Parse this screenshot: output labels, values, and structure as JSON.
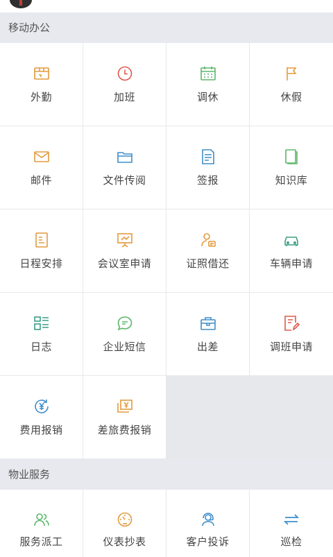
{
  "sections": [
    {
      "title": "移动办公",
      "items": [
        {
          "label": "外勤",
          "icon": "field-work-icon"
        },
        {
          "label": "加班",
          "icon": "clock-icon"
        },
        {
          "label": "调休",
          "icon": "calendar-icon"
        },
        {
          "label": "休假",
          "icon": "flag-icon"
        },
        {
          "label": "邮件",
          "icon": "mail-icon"
        },
        {
          "label": "文件传阅",
          "icon": "folder-icon"
        },
        {
          "label": "签报",
          "icon": "document-icon"
        },
        {
          "label": "知识库",
          "icon": "book-icon"
        },
        {
          "label": "日程安排",
          "icon": "schedule-icon"
        },
        {
          "label": "会议室申请",
          "icon": "presentation-icon"
        },
        {
          "label": "证照借还",
          "icon": "id-card-icon"
        },
        {
          "label": "车辆申请",
          "icon": "car-icon"
        },
        {
          "label": "日志",
          "icon": "log-list-icon"
        },
        {
          "label": "企业短信",
          "icon": "chat-icon"
        },
        {
          "label": "出差",
          "icon": "briefcase-icon"
        },
        {
          "label": "调班申请",
          "icon": "shift-edit-icon"
        },
        {
          "label": "费用报销",
          "icon": "yuan-refund-icon"
        },
        {
          "label": "差旅费报销",
          "icon": "travel-expense-icon"
        }
      ]
    },
    {
      "title": "物业服务",
      "items": [
        {
          "label": "服务派工",
          "icon": "dispatch-people-icon"
        },
        {
          "label": "仪表抄表",
          "icon": "meter-gauge-icon"
        },
        {
          "label": "客户投诉",
          "icon": "headset-icon"
        },
        {
          "label": "巡检",
          "icon": "patrol-arrows-icon"
        }
      ]
    }
  ],
  "colors": {
    "orange": "#e39a3e",
    "red": "#e0584b",
    "green": "#5bb66b",
    "blue": "#3f8ec9",
    "teal": "#3a9e84"
  }
}
